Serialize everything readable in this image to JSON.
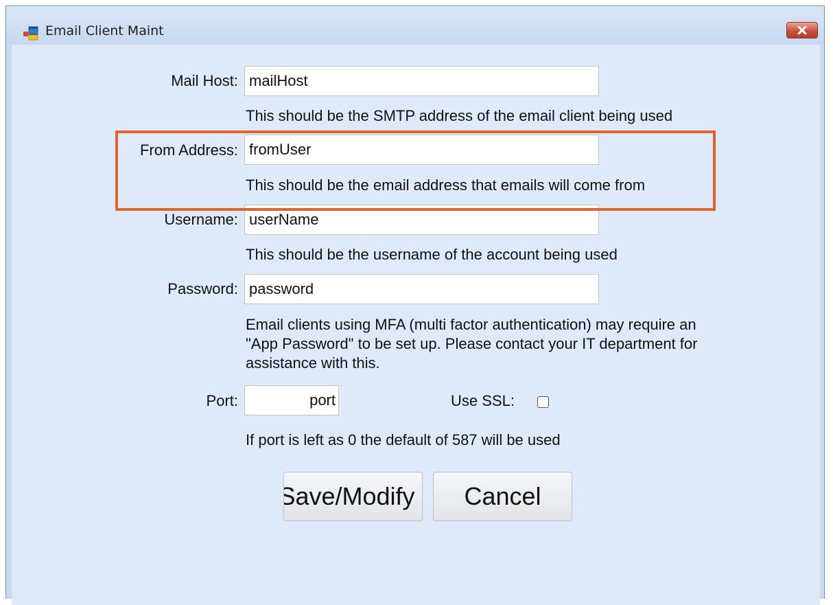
{
  "window": {
    "title": "Email Client Maint"
  },
  "form": {
    "mail_host": {
      "label": "Mail Host:",
      "value": "mailHost",
      "help": "This should be the SMTP address of the email client being used"
    },
    "from_address": {
      "label": "From Address:",
      "value": "fromUser",
      "help": "This should be the email address that emails will come from"
    },
    "username": {
      "label": "Username:",
      "value": "userName",
      "help": "This should be the username of the account being used"
    },
    "password": {
      "label": "Password:",
      "value": "password",
      "help_lines": [
        "Email clients using MFA (multi factor authentication) may require an",
        "\"App Password\" to be set up. Please contact your IT department for",
        "assistance with this."
      ]
    },
    "port": {
      "label": "Port:",
      "value": "port",
      "help": "If port is left as 0 the default of 587 will be used"
    },
    "use_ssl": {
      "label": "Use SSL:",
      "checked": false
    }
  },
  "buttons": {
    "save": "Save/Modify",
    "cancel": "Cancel"
  },
  "colors": {
    "highlight": "#e0642a",
    "client_bg": "#deeafa",
    "close_button": "#c9513f"
  },
  "icons": {
    "app": "app-window-icon",
    "close": "close-icon"
  }
}
